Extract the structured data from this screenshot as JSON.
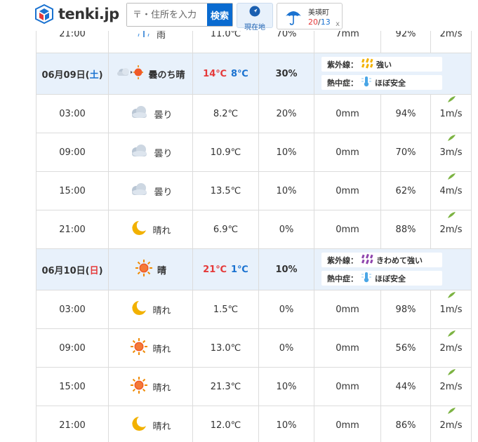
{
  "header": {
    "logo_text": "tenki.jp",
    "search_placeholder": "〒・住所を入力",
    "search_button": "検索",
    "location_button": "現在地",
    "favorite": {
      "name": "美瑛町",
      "hi": "20",
      "sep": "/",
      "lo": "13",
      "close": "x"
    }
  },
  "colors": {
    "accent": "#0a6bd0",
    "day_row_bg": "#e8f1fb",
    "high_temp": "#e53939",
    "low_temp": "#1a72d0"
  },
  "rows": [
    {
      "type": "hour",
      "time": "21:00",
      "icon": "rain-icon",
      "weather": "雨",
      "temp": "11.0℃",
      "prob": "70%",
      "precip": "7mm",
      "humidity": "92%",
      "wind": "2m/s"
    },
    {
      "type": "day",
      "date_prefix": "06月09日(",
      "dow": "土",
      "date_suffix": ")",
      "icon": "cloudy-then-sunny-icon",
      "weather": "曇のち晴",
      "hi": "14℃",
      "lo": "8℃",
      "prob": "30%",
      "uv_label": "紫外線：",
      "uv_value": "強い",
      "heat_label": "熱中症：",
      "heat_value": "ほぼ安全"
    },
    {
      "type": "hour",
      "time": "03:00",
      "icon": "cloudy-icon",
      "weather": "曇り",
      "temp": "8.2℃",
      "prob": "20%",
      "precip": "0mm",
      "humidity": "94%",
      "wind": "1m/s"
    },
    {
      "type": "hour",
      "time": "09:00",
      "icon": "cloudy-icon",
      "weather": "曇り",
      "temp": "10.9℃",
      "prob": "10%",
      "precip": "0mm",
      "humidity": "70%",
      "wind": "3m/s"
    },
    {
      "type": "hour",
      "time": "15:00",
      "icon": "cloudy-icon",
      "weather": "曇り",
      "temp": "13.5℃",
      "prob": "10%",
      "precip": "0mm",
      "humidity": "62%",
      "wind": "4m/s"
    },
    {
      "type": "hour",
      "time": "21:00",
      "icon": "moon-icon",
      "weather": "晴れ",
      "temp": "6.9℃",
      "prob": "0%",
      "precip": "0mm",
      "humidity": "88%",
      "wind": "2m/s"
    },
    {
      "type": "day",
      "date_prefix": "06月10日(",
      "dow": "日",
      "date_suffix": ")",
      "icon": "sun-icon",
      "weather": "晴",
      "hi": "21℃",
      "lo": "1℃",
      "prob": "10%",
      "uv_label": "紫外線：",
      "uv_value": "きわめて強い",
      "heat_label": "熱中症：",
      "heat_value": "ほぼ安全"
    },
    {
      "type": "hour",
      "time": "03:00",
      "icon": "moon-icon",
      "weather": "晴れ",
      "temp": "1.5℃",
      "prob": "0%",
      "precip": "0mm",
      "humidity": "98%",
      "wind": "1m/s"
    },
    {
      "type": "hour",
      "time": "09:00",
      "icon": "sun-icon",
      "weather": "晴れ",
      "temp": "13.0℃",
      "prob": "0%",
      "precip": "0mm",
      "humidity": "56%",
      "wind": "2m/s"
    },
    {
      "type": "hour",
      "time": "15:00",
      "icon": "sun-icon",
      "weather": "晴れ",
      "temp": "21.3℃",
      "prob": "10%",
      "precip": "0mm",
      "humidity": "44%",
      "wind": "2m/s"
    },
    {
      "type": "hour",
      "time": "21:00",
      "icon": "moon-icon",
      "weather": "晴れ",
      "temp": "12.0℃",
      "prob": "10%",
      "precip": "0mm",
      "humidity": "86%",
      "wind": "2m/s"
    }
  ]
}
